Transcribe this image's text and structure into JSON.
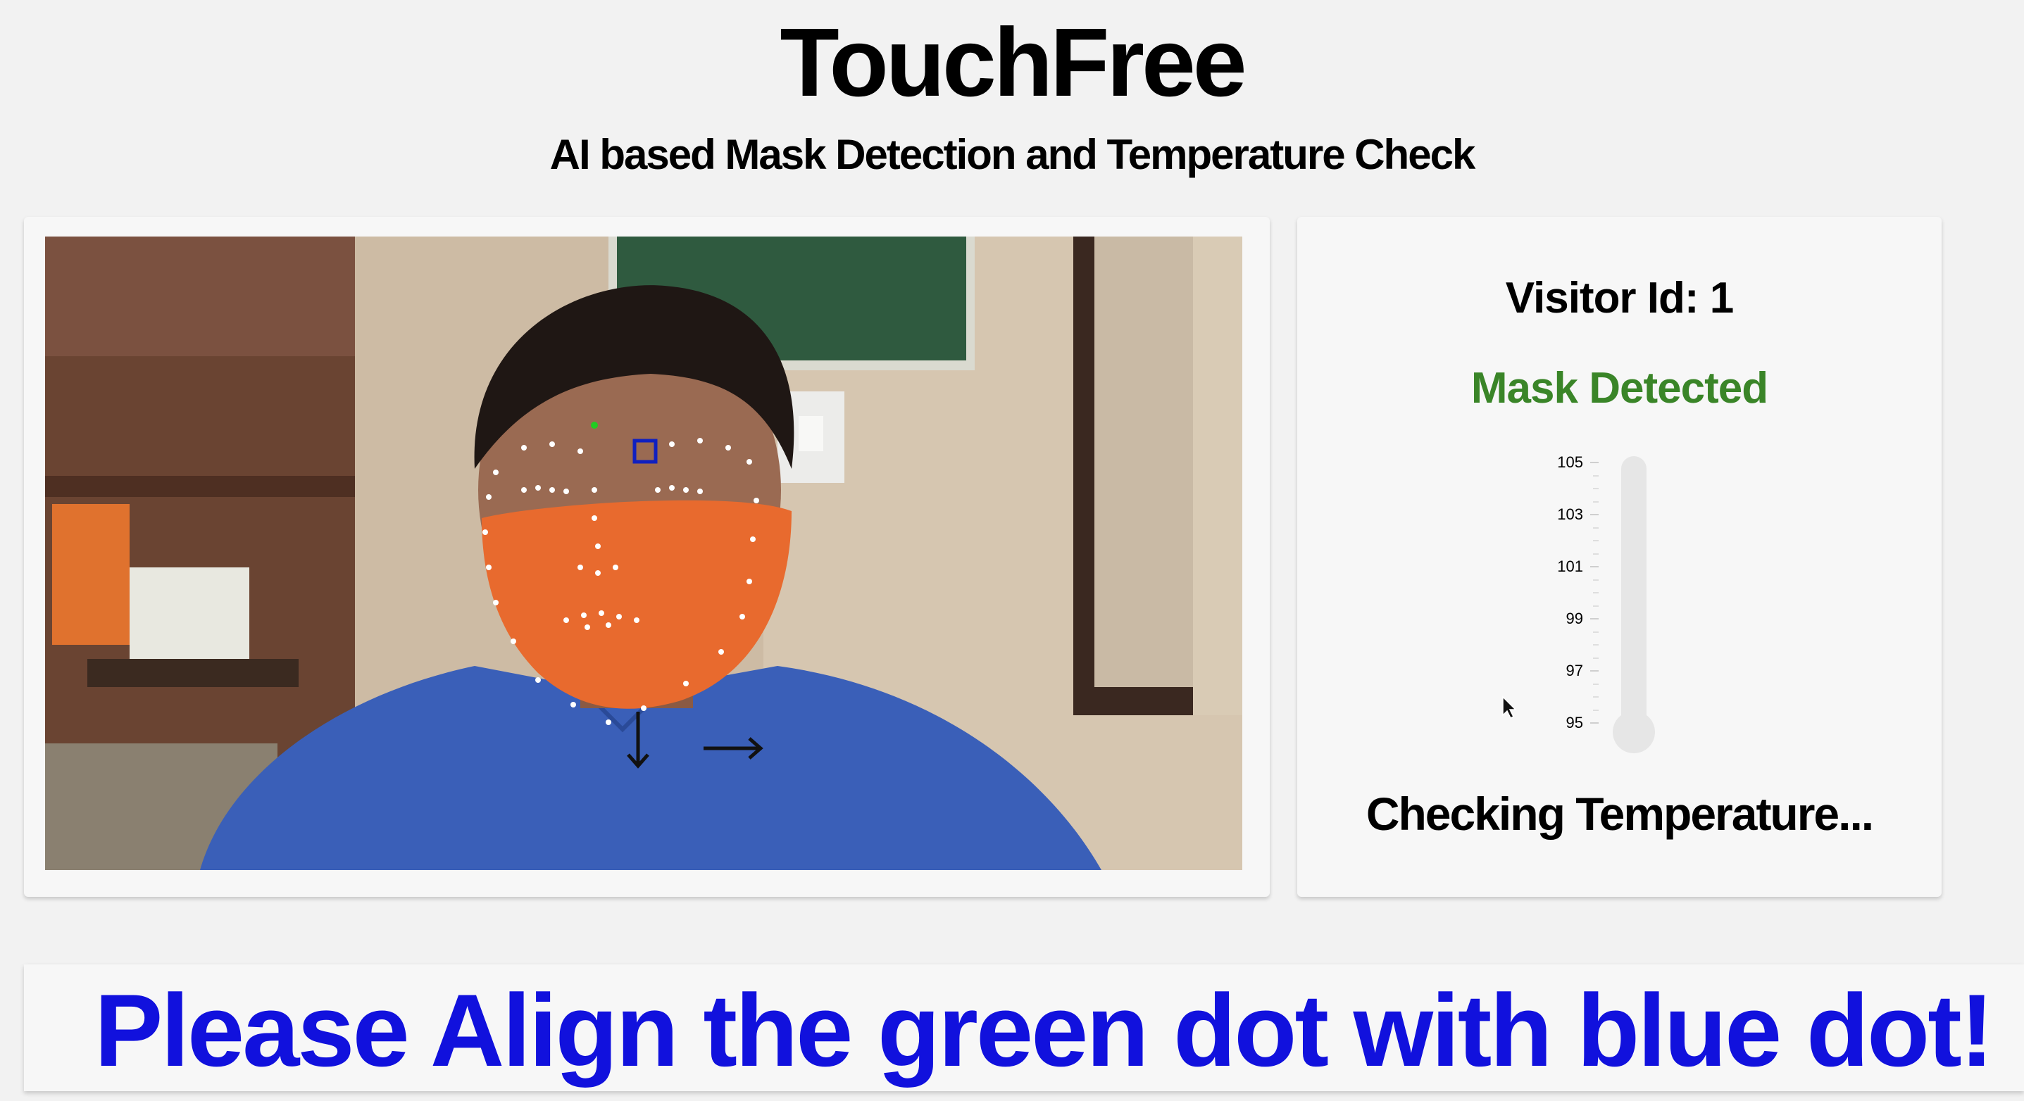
{
  "header": {
    "title": "TouchFree",
    "subtitle": "AI based Mask Detection and Temperature Check"
  },
  "video": {
    "overlay_arrows": [
      "arrow-down-icon",
      "arrow-right-icon"
    ]
  },
  "info": {
    "visitor_label": "Visitor Id: 1",
    "mask_status": "Mask Detected",
    "mask_status_color": "#3a8528",
    "thermometer": {
      "ticks": [
        "105",
        "103",
        "101",
        "99",
        "97",
        "95"
      ],
      "fill_level": 0
    },
    "temperature_status": "Checking Temperature..."
  },
  "banner": {
    "message": "Please Align the green dot with blue dot!",
    "color": "#1111dd"
  }
}
